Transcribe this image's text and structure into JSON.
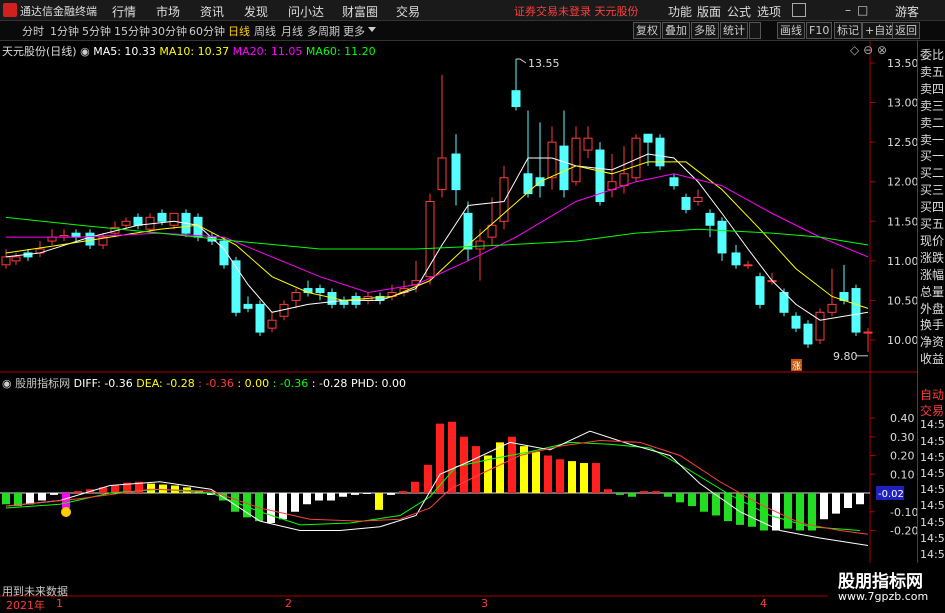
{
  "app": {
    "title": "通达信金融终端",
    "menus": [
      "行情",
      "市场",
      "资讯",
      "发现",
      "问小达",
      "财富圈",
      "交易"
    ],
    "notice": "证券交易未登录  天元股份",
    "right_menus": [
      "功能",
      "版面",
      "公式",
      "选项"
    ],
    "guest": "游客"
  },
  "toolbar": {
    "periods": [
      "分时",
      "1分钟",
      "5分钟",
      "15分钟",
      "30分钟",
      "60分钟",
      "日线",
      "周线",
      "月线",
      "多周期",
      "更多"
    ],
    "active_period": "日线",
    "right_buttons": [
      "复权",
      "叠加",
      "多股",
      "统计",
      "画线",
      "F10",
      "标记",
      "+自选",
      "返回"
    ]
  },
  "kline": {
    "stock_label": "天元股份(日线)",
    "ma_legend": [
      {
        "text": "MA5: 10.33",
        "color": "#ffffff"
      },
      {
        "text": "MA10: 10.37",
        "color": "#ffff00"
      },
      {
        "text": "MA20: 11.05",
        "color": "#ff00ff"
      },
      {
        "text": "MA60: 11.20",
        "color": "#00ff00"
      }
    ],
    "high_label": "13.55",
    "low_label": "9.80",
    "y_ticks": [
      "13.50",
      "13.00",
      "12.50",
      "12.00",
      "11.50",
      "11.00",
      "10.50",
      "10.00"
    ],
    "badge": "涨"
  },
  "macd": {
    "legend": [
      {
        "text": "股朋指标网",
        "color": "#c8c8c8"
      },
      {
        "text": "DIFF: -0.36",
        "color": "#ffffff"
      },
      {
        "text": "DEA: -0.28",
        "color": "#ffff00"
      },
      {
        "text": ": -0.36",
        "color": "#ff3c3c"
      },
      {
        "text": ": 0.00",
        "color": "#ffff00"
      },
      {
        "text": ": -0.36",
        "color": "#00ff00"
      },
      {
        "text": ": -0.28",
        "color": "#ffffff"
      },
      {
        "text": "PHD: 0.00",
        "color": "#ffffff"
      }
    ],
    "y_ticks": [
      "0.40",
      "0.30",
      "0.20",
      "0.10",
      "-0.10",
      "-0.20"
    ],
    "zero_value": "-0.02"
  },
  "bottom": {
    "footnote": "用到未来数据",
    "year": "2021年",
    "months": [
      "1",
      "2",
      "3",
      "4"
    ]
  },
  "right_panel": {
    "labels_top": [
      "委比",
      "卖五",
      "卖四",
      "卖三",
      "卖二",
      "卖一",
      "买一",
      "买二",
      "买三",
      "买四",
      "买五",
      "现价",
      "涨跌",
      "涨幅",
      "总量",
      "外盘",
      "换手",
      "净资",
      "收益"
    ],
    "labels_bottom": [
      "自动",
      "交易",
      "14:56",
      "14:56",
      "14:56",
      "14:56",
      "14:56",
      "14:56",
      "14:56",
      "14:56",
      "14:56",
      "14:56",
      "14:56"
    ]
  },
  "watermark": {
    "main": "股朋指标网",
    "sub": "www.7gpzb.com"
  },
  "colors": {
    "up": "#ff3c3c",
    "down": "#54ffff",
    "ma5": "#ffffff",
    "ma10": "#ffff00",
    "ma20": "#ff00ff",
    "ma60": "#00ff00"
  }
}
